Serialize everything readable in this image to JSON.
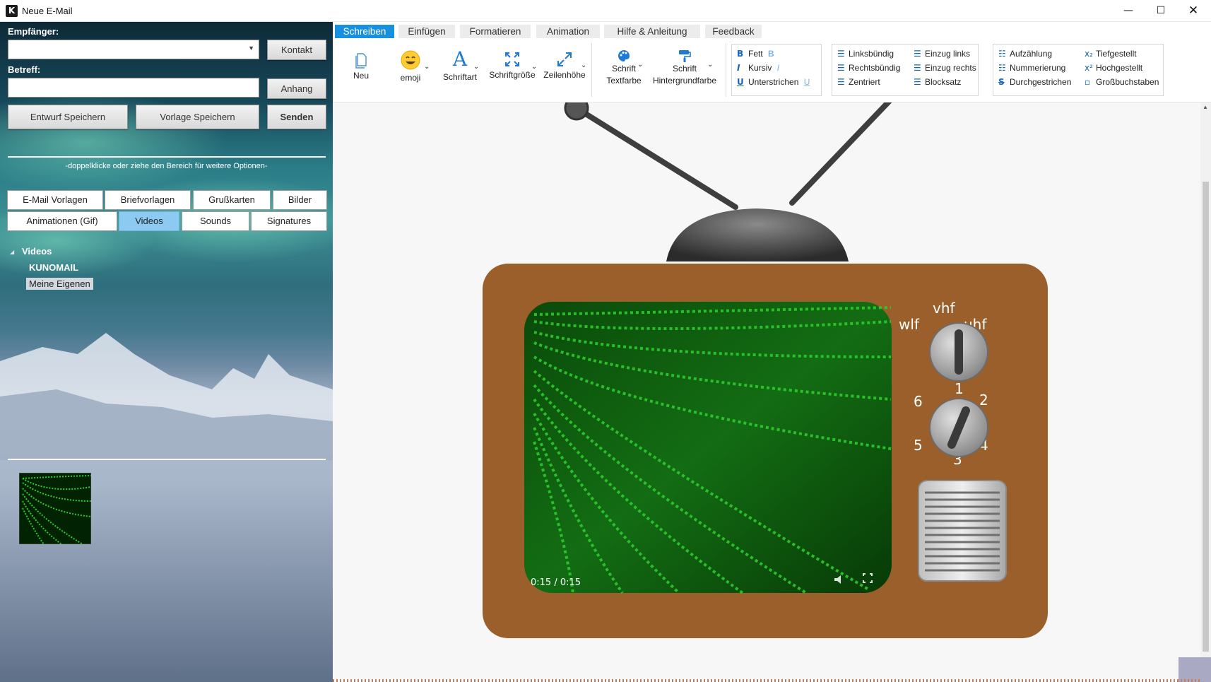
{
  "window": {
    "title": "Neue E-Mail",
    "app_icon": "K",
    "controls": {
      "minimize": "—",
      "maximize": "☐",
      "close": "✕"
    }
  },
  "compose": {
    "recipient_label": "Empfänger:",
    "recipient_value": "",
    "contact_button": "Kontakt",
    "subject_label": "Betreff:",
    "subject_value": "",
    "attachment_button": "Anhang",
    "save_draft_button": "Entwurf Speichern",
    "save_template_button": "Vorlage Speichern",
    "send_button": "Senden",
    "hint": "-doppelklicke oder ziehe den Bereich für weitere Optionen-"
  },
  "library_tabs": {
    "row1": [
      "E-Mail Vorlagen",
      "Briefvorlagen",
      "Grußkarten",
      "Bilder"
    ],
    "row2": [
      "Animationen (Gif)",
      "Videos",
      "Sounds",
      "Signatures"
    ],
    "active": "Videos"
  },
  "tree": {
    "root": "Videos",
    "children": [
      "KUNOMAIL",
      "Meine Eigenen"
    ],
    "selected": "Meine Eigenen"
  },
  "ribbon": {
    "tabs": [
      "Schreiben",
      "Einfügen",
      "Formatieren",
      "Animation",
      "Hilfe & Anleitung",
      "Feedback"
    ],
    "active_tab": "Schreiben",
    "buttons": {
      "new": "Neu",
      "emoji": "emoji",
      "font": "Schriftart",
      "font_size": "Schriftgröße",
      "line_height": "Zeilenhöhe",
      "text_color_1": "Schrift",
      "text_color_2": "Textfarbe",
      "bg_color_1": "Schrift",
      "bg_color_2": "Hintergrundfarbe"
    },
    "style": {
      "bold": "Fett",
      "italic": "Kursiv",
      "underline": "Unterstrichen"
    },
    "align": {
      "left": "Linksbündig",
      "right": "Rechtsbündig",
      "center": "Zentriert",
      "indent_left": "Einzug links",
      "indent_right": "Einzug rechts",
      "justify": "Blocksatz"
    },
    "lists": {
      "bullets": "Aufzählung",
      "numbering": "Nummerierung",
      "strike": "Durchgestrichen",
      "subscript": "Tiefgestellt",
      "superscript": "Hochgestellt",
      "uppercase": "Großbuchstaben"
    }
  },
  "tv": {
    "dial_top_labels": {
      "left": "wlf",
      "center": "vhf",
      "right": "uhf"
    },
    "dial_numbers": [
      "1",
      "2",
      "4",
      "3",
      "5",
      "6"
    ],
    "video_time": "0:15 / 0:15",
    "colors": {
      "cabinet": "#9a5f2a",
      "screen": "#1aa31a",
      "accent": "#1890e0"
    }
  }
}
